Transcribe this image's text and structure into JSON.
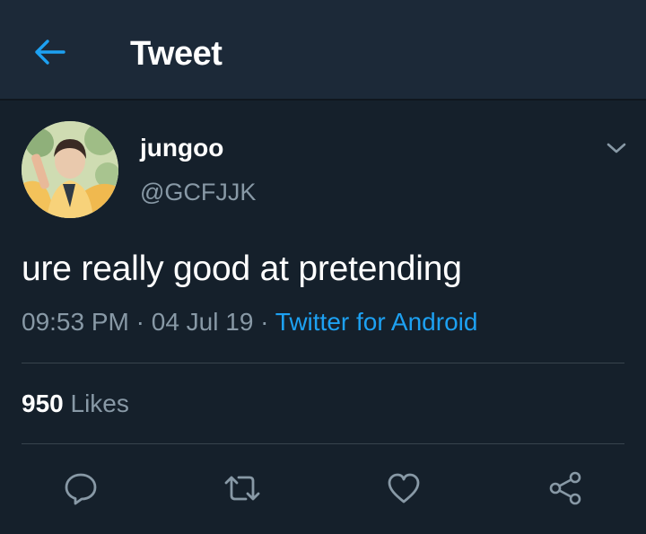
{
  "header": {
    "title": "Tweet",
    "back_icon": "arrow-left-icon",
    "accent_color": "#1da1f2"
  },
  "tweet": {
    "display_name": "jungoo",
    "handle": "@GCFJJK",
    "text": "ure really good at pretending",
    "time": "09:53 PM",
    "separator": "·",
    "date": "04 Jul 19",
    "source": "Twitter for Android",
    "likes_count": "950",
    "likes_label": "Likes"
  },
  "actions": {
    "reply_icon": "reply-icon",
    "retweet_icon": "retweet-icon",
    "like_icon": "heart-icon",
    "share_icon": "share-icon"
  },
  "colors": {
    "background": "#15202b",
    "header_background": "#1c2938",
    "secondary_text": "#8899a6",
    "link": "#1da1f2",
    "divider": "#38444d"
  }
}
